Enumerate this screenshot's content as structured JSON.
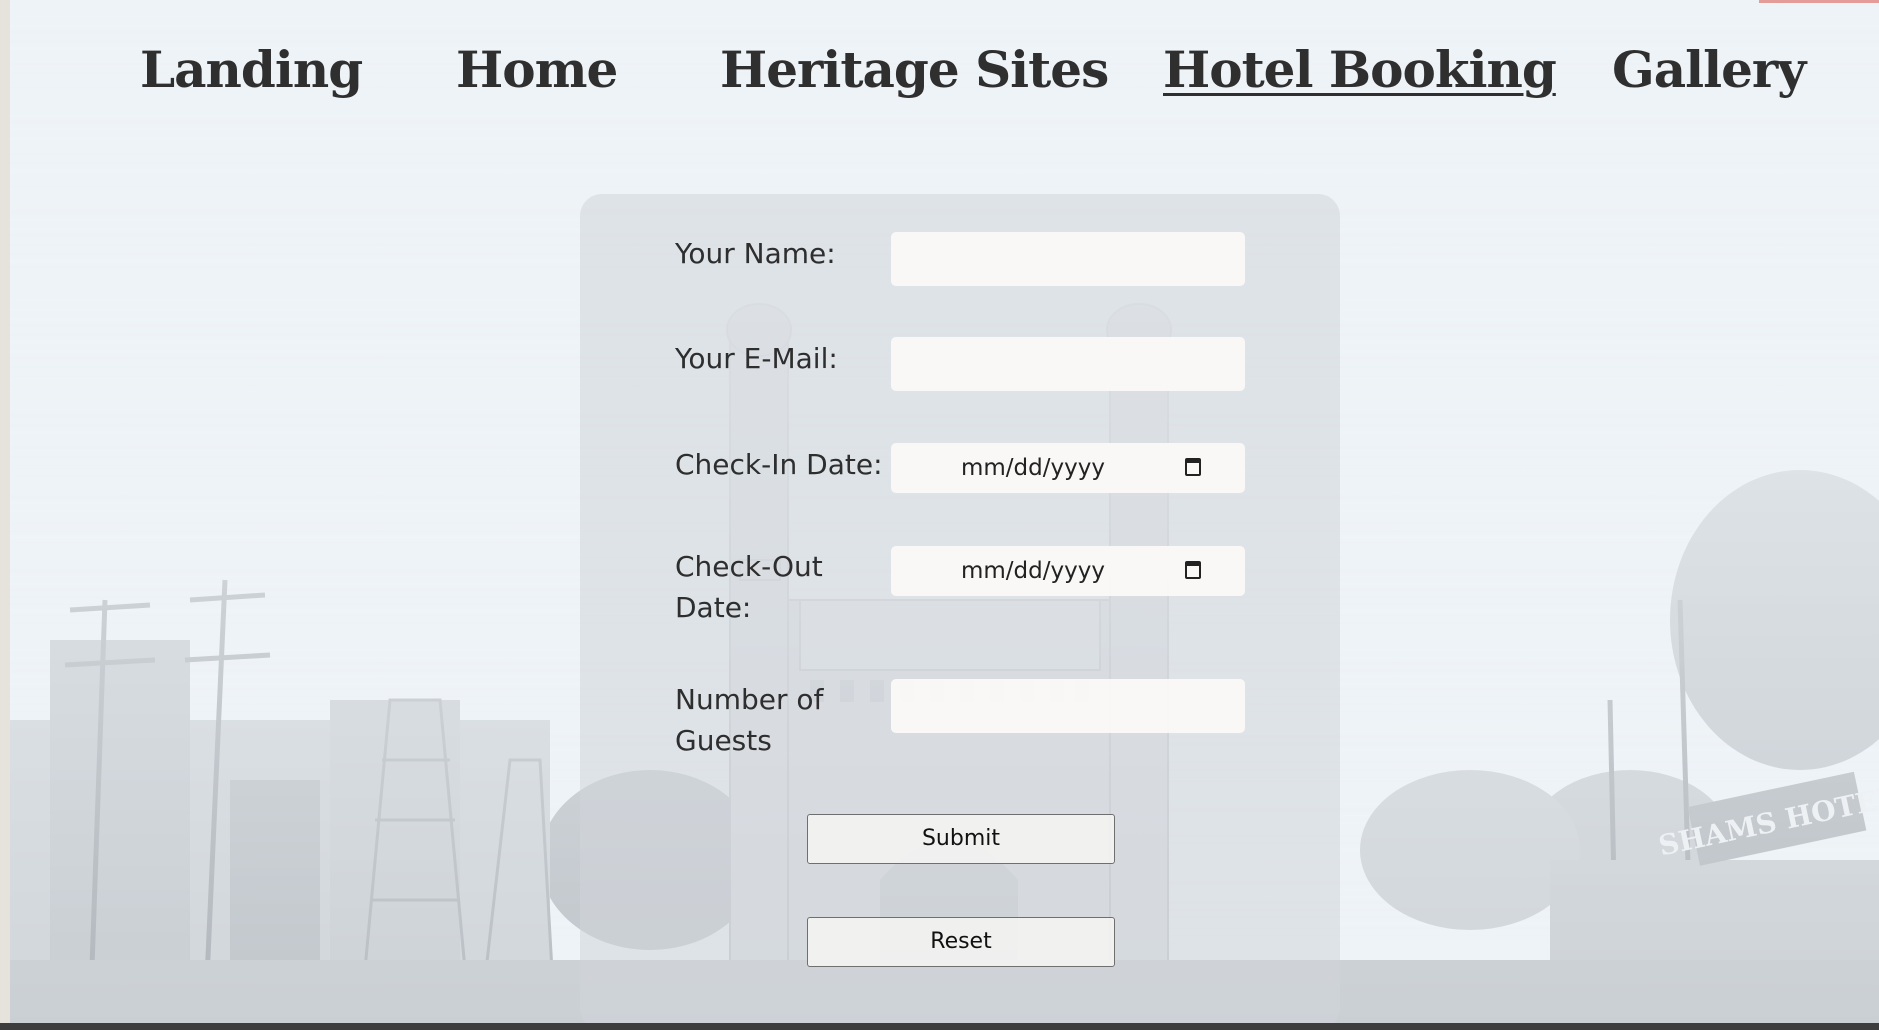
{
  "nav": {
    "items": [
      {
        "label": "Landing"
      },
      {
        "label": "Home"
      },
      {
        "label": "Heritage Sites"
      },
      {
        "label": "Hotel Booking"
      },
      {
        "label": "Gallery"
      }
    ]
  },
  "form": {
    "name_label": "Your Name:",
    "name_value": "",
    "email_label": "Your E-Mail:",
    "email_value": "",
    "checkin_label": "Check-In Date:",
    "checkin_placeholder": "mm/dd/yyyy",
    "checkout_label": "Check-Out Date:",
    "checkout_placeholder": "mm/dd/yyyy",
    "guests_label": "Number of Guests",
    "guests_value": "",
    "submit_label": "Submit",
    "reset_label": "Reset"
  },
  "background": {
    "sign_text": "SHAMS HOTEL"
  },
  "colors": {
    "page_bg": "#eef3f7",
    "nav_text": "#2f2f2f",
    "panel_bg": "#d2d6da",
    "accent_red": "#d9332b"
  }
}
